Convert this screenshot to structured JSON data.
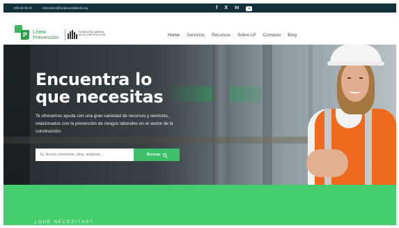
{
  "topbar": {
    "phone": "900 20 30 20",
    "email": "infocentro@fundacionlaboral.org",
    "social": [
      "f",
      "X",
      "in"
    ]
  },
  "header": {
    "logo_line1": "Línea",
    "logo_line2": "Prevención",
    "logo_mark_letter": "P",
    "partner_text": "FUNDACIÓN LABORAL DE LA CONSTRUCCIÓN",
    "nav": [
      {
        "label": "Home",
        "active": true
      },
      {
        "label": "Servicios",
        "active": false
      },
      {
        "label": "Recursos",
        "active": false
      },
      {
        "label": "Sobre LP",
        "active": false
      },
      {
        "label": "Contacto",
        "active": false
      },
      {
        "label": "Blog",
        "active": false
      }
    ]
  },
  "hero": {
    "title_line1": "Encuentra lo",
    "title_line2": "que necesitas",
    "description": "Te ofrecemos ayuda con una gran variedad de recursos y servicios, relacionados con la prevención de riesgos laborales en el sector de la construcción.",
    "search_placeholder": "Ej. Acción correctiva, obra, andamio...",
    "search_button": "Buscar"
  },
  "section": {
    "heading": "¿QUÉ NECESITAS?"
  },
  "colors": {
    "topbar": "#13303b",
    "accent_green": "#3dbf69",
    "section_green": "#46cd6e",
    "brand_green": "#2e9a4a"
  },
  "icons": [
    "facebook-icon",
    "x-icon",
    "linkedin-icon",
    "youtube-icon",
    "search-icon"
  ]
}
